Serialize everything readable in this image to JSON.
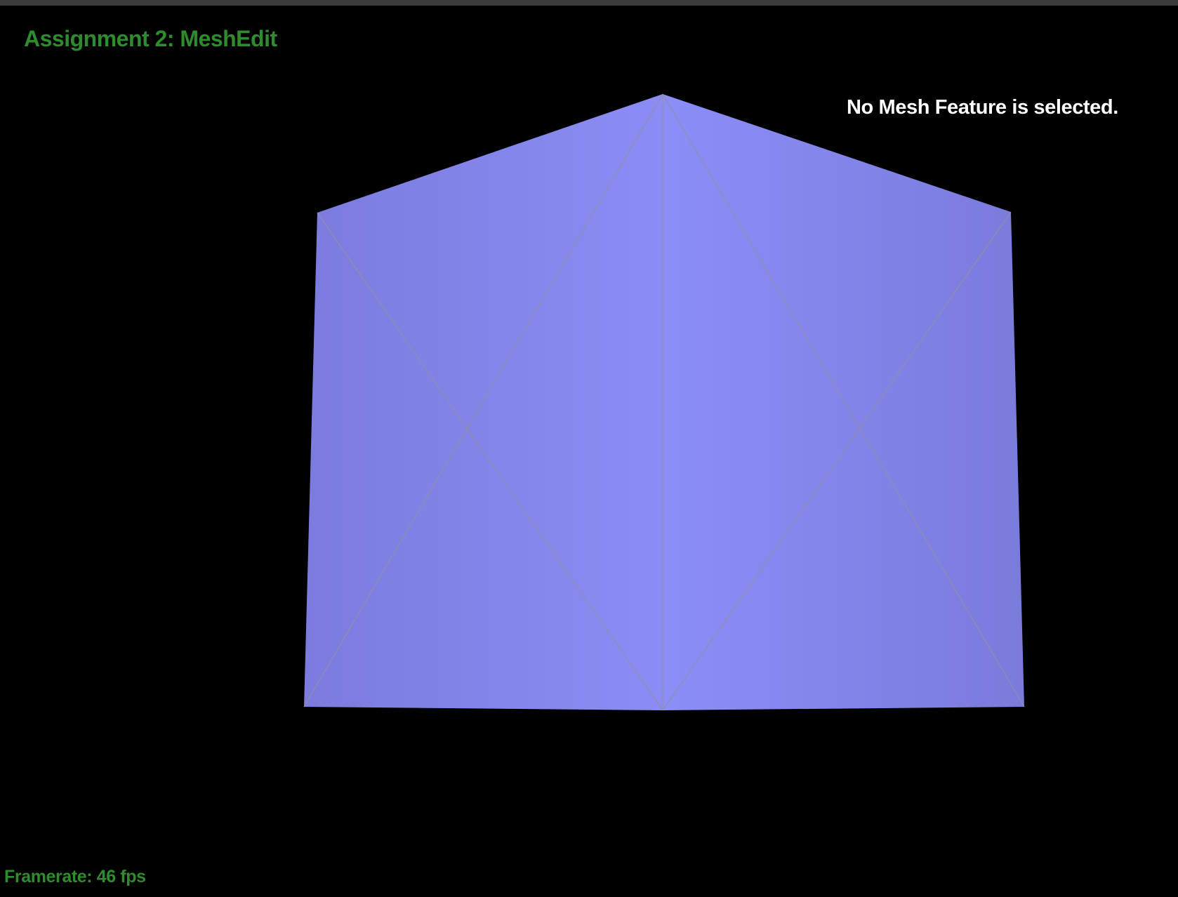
{
  "window": {
    "title": "Assignment 2: MeshEdit"
  },
  "status": {
    "selection": "No Mesh Feature is selected."
  },
  "footer": {
    "framerate": "Framerate: 46 fps"
  },
  "mesh": {
    "face_color": "#8a8cf2",
    "edge_color": "#8f8fa8",
    "background": "#000000",
    "title_color": "#2e8b2e"
  }
}
